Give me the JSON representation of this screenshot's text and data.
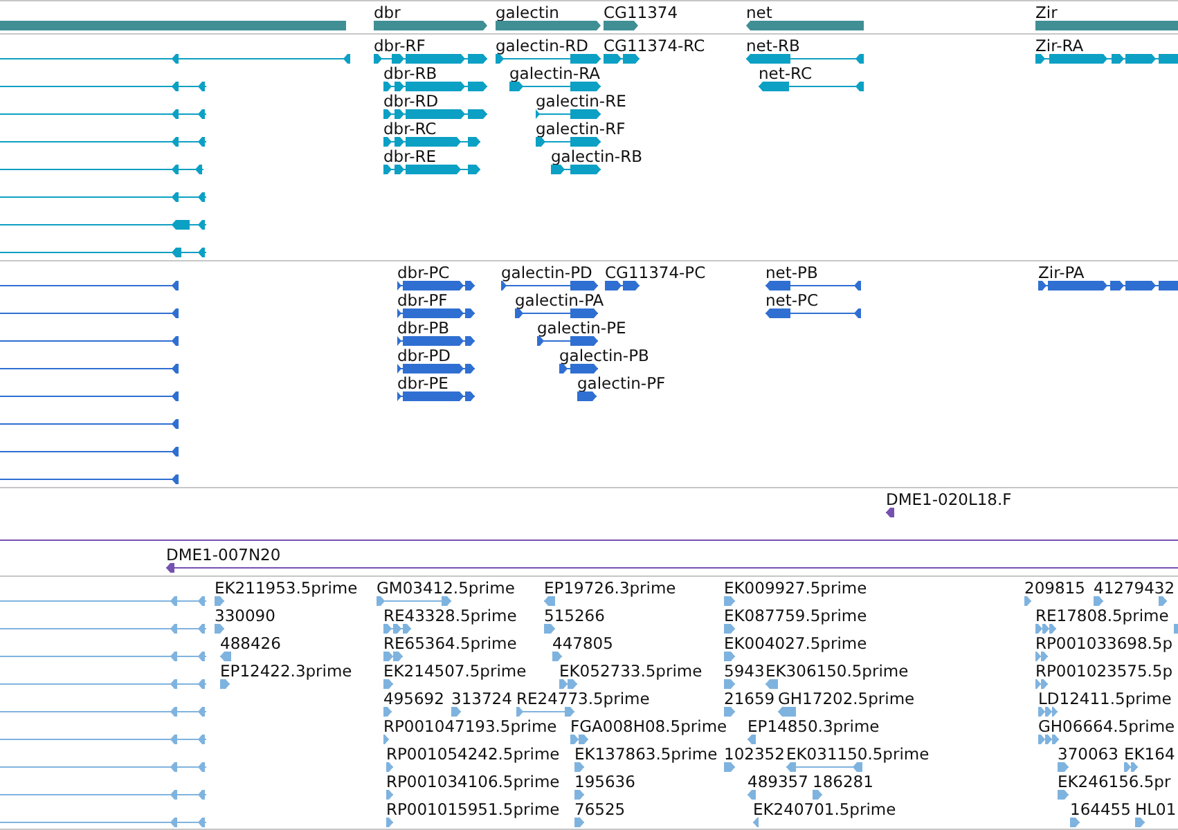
{
  "tracks": [
    {
      "kind": "gene",
      "color": "#3f8f94",
      "rows": [
        {
          "features": [
            {
              "reverse": true
            },
            {
              "label": "dbr",
              "reverse": false
            },
            {
              "label": "galectin",
              "reverse": false
            },
            {
              "label": "CG11374",
              "reverse": false
            },
            {
              "label": "net",
              "reverse": true
            },
            {
              "label": "Zir",
              "reverse": false
            }
          ]
        }
      ]
    },
    {
      "kind": "transcript",
      "color": "#0ca0c4",
      "rows": [
        {
          "features": [
            {
              "reverse": true
            },
            {
              "label": "dbr-RF",
              "reverse": false
            },
            {
              "label": "galectin-RD",
              "reverse": false
            },
            {
              "label": "CG11374-RC",
              "reverse": false
            },
            {
              "label": "net-RB",
              "reverse": true
            },
            {
              "label": "Zir-RA",
              "reverse": false
            }
          ]
        },
        {
          "features": [
            {
              "reverse": true
            },
            {
              "label": "dbr-RB",
              "reverse": false
            },
            {
              "label": "galectin-RA",
              "reverse": false
            },
            {
              "label": "net-RC",
              "reverse": true
            }
          ]
        },
        {
          "features": [
            {
              "reverse": true
            },
            {
              "label": "dbr-RD",
              "reverse": false
            },
            {
              "label": "galectin-RE",
              "reverse": false
            }
          ]
        },
        {
          "features": [
            {
              "reverse": true
            },
            {
              "label": "dbr-RC",
              "reverse": false
            },
            {
              "label": "galectin-RF",
              "reverse": false
            }
          ]
        },
        {
          "features": [
            {
              "reverse": true
            },
            {
              "label": "dbr-RE",
              "reverse": false
            },
            {
              "label": "galectin-RB",
              "reverse": false
            }
          ]
        },
        {
          "features": [
            {
              "reverse": true
            }
          ]
        },
        {
          "features": [
            {
              "reverse": true
            }
          ]
        },
        {
          "features": [
            {
              "reverse": true
            }
          ]
        }
      ]
    },
    {
      "kind": "protein",
      "color": "#2f6fd2",
      "rows": [
        {
          "features": [
            {
              "reverse": true
            },
            {
              "label": "dbr-PC",
              "reverse": false
            },
            {
              "label": "galectin-PD",
              "reverse": false
            },
            {
              "label": "CG11374-PC",
              "reverse": false
            },
            {
              "label": "net-PB",
              "reverse": true
            },
            {
              "label": "Zir-PA",
              "reverse": false
            }
          ]
        },
        {
          "features": [
            {
              "reverse": true
            },
            {
              "label": "dbr-PF",
              "reverse": false
            },
            {
              "label": "galectin-PA",
              "reverse": false
            },
            {
              "label": "net-PC",
              "reverse": true
            }
          ]
        },
        {
          "features": [
            {
              "reverse": true
            },
            {
              "label": "dbr-PB",
              "reverse": false
            },
            {
              "label": "galectin-PE",
              "reverse": false
            }
          ]
        },
        {
          "features": [
            {
              "reverse": true
            },
            {
              "label": "dbr-PD",
              "reverse": false
            },
            {
              "label": "galectin-PB",
              "reverse": false
            }
          ]
        },
        {
          "features": [
            {
              "reverse": true
            },
            {
              "label": "dbr-PE",
              "reverse": false
            },
            {
              "label": "galectin-PF",
              "reverse": false
            }
          ]
        },
        {
          "features": [
            {
              "reverse": true
            }
          ]
        },
        {
          "features": [
            {
              "reverse": true
            }
          ]
        },
        {
          "features": [
            {
              "reverse": true
            }
          ]
        }
      ]
    },
    {
      "kind": "clone",
      "color": "#7652b0",
      "rows": [
        {
          "features": [
            {
              "label": "DME1-020L18.F",
              "reverse": true
            }
          ]
        },
        {
          "features": [
            {
              "clipped": true
            }
          ]
        },
        {
          "features": [
            {
              "label": "DME1-007N20",
              "reverse": true
            }
          ]
        }
      ]
    },
    {
      "kind": "est",
      "color": "#7fb3df",
      "rows": [
        {
          "features": [
            {
              "reverse": true
            },
            {
              "label": "EK211953.5prime",
              "reverse": false
            },
            {
              "label": "GM03412.5prime",
              "reverse": false
            },
            {
              "label": "EP19726.3prime",
              "reverse": true
            },
            {
              "label": "EK009927.5prime",
              "reverse": false
            },
            {
              "label": "209815",
              "reverse": false
            },
            {
              "label": "41279432",
              "reverse": false
            },
            {
              "reverse": false
            }
          ]
        },
        {
          "features": [
            {
              "reverse": true
            },
            {
              "label": "330090",
              "reverse": false
            },
            {
              "label": "RE43328.5prime",
              "reverse": false
            },
            {
              "label": "515266",
              "reverse": false
            },
            {
              "label": "EK087759.5prime",
              "reverse": false
            },
            {
              "label": "RE17808.5prime",
              "reverse": false
            },
            {
              "reverse": false
            }
          ]
        },
        {
          "features": [
            {
              "reverse": true
            },
            {
              "label": "488426",
              "reverse": true
            },
            {
              "label": "RE65364.5prime",
              "reverse": false
            },
            {
              "label": "447805",
              "reverse": false
            },
            {
              "label": "EK004027.5prime",
              "reverse": false
            },
            {
              "label": "RP001033698.5p",
              "reverse": false
            }
          ]
        },
        {
          "features": [
            {
              "reverse": true
            },
            {
              "label": "EP12422.3prime",
              "reverse": false
            },
            {
              "label": "EK214507.5prime",
              "reverse": false
            },
            {
              "label": "EK052733.5prime",
              "reverse": false
            },
            {
              "label": "5943",
              "reverse": false
            },
            {
              "label": "EK306150.5prime",
              "reverse": true
            },
            {
              "label": "RP001023575.5p",
              "reverse": false
            }
          ]
        },
        {
          "features": [
            {
              "reverse": true
            },
            {
              "label": "495692",
              "reverse": false
            },
            {
              "label": "313724",
              "reverse": false
            },
            {
              "label": "RE24773.5prime",
              "reverse": false
            },
            {
              "label": "21659",
              "reverse": false
            },
            {
              "label": "GH17202.5prime",
              "reverse": true
            },
            {
              "label": "LD12411.5prime",
              "reverse": false
            }
          ]
        },
        {
          "features": [
            {
              "reverse": true
            },
            {
              "label": "RP001047193.5prime",
              "reverse": false
            },
            {
              "label": "FGA008H08.5prime",
              "reverse": false
            },
            {
              "label": "EP14850.3prime",
              "reverse": true
            },
            {
              "label": "GH06664.5prime",
              "reverse": false
            }
          ]
        },
        {
          "features": [
            {
              "reverse": true
            },
            {
              "label": "RP001054242.5prime",
              "reverse": false
            },
            {
              "label": "EK137863.5prime",
              "reverse": false
            },
            {
              "label": "102352",
              "reverse": false
            },
            {
              "label": "EK031150.5prime",
              "reverse": true
            },
            {
              "label": "370063",
              "reverse": false
            },
            {
              "label": "EK164",
              "reverse": false
            }
          ]
        },
        {
          "features": [
            {
              "reverse": true
            },
            {
              "label": "RP001034106.5prime",
              "reverse": false
            },
            {
              "label": "195636",
              "reverse": false
            },
            {
              "label": "489357",
              "reverse": true
            },
            {
              "label": "186281",
              "reverse": false
            },
            {
              "label": "EK246156.5pr",
              "reverse": false
            }
          ]
        },
        {
          "features": [
            {
              "reverse": true
            },
            {
              "label": "RP001015951.5prime",
              "reverse": false
            },
            {
              "label": "76525",
              "reverse": false
            },
            {
              "label": "EK240701.5prime",
              "reverse": true
            },
            {
              "label": "164455",
              "reverse": false
            },
            {
              "label": "HL01",
              "reverse": false
            }
          ]
        }
      ]
    }
  ]
}
